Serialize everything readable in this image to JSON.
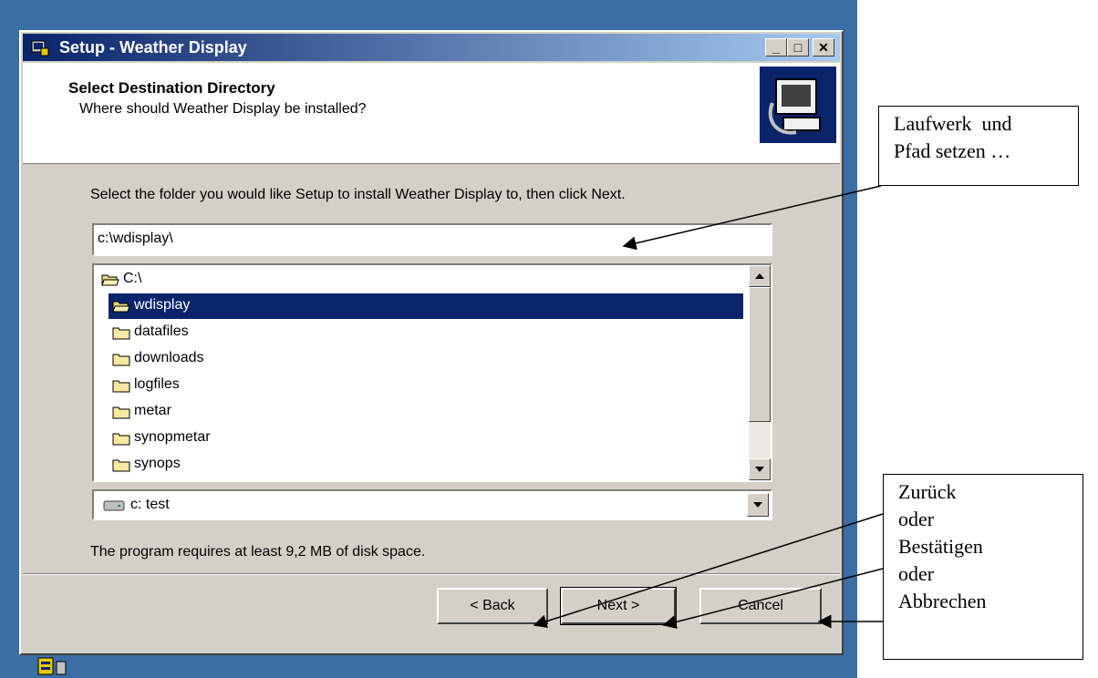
{
  "window": {
    "title": "Setup - Weather Display",
    "controls": {
      "minimize": "_",
      "maximize": "□",
      "close": "✕"
    }
  },
  "header": {
    "title": "Select Destination Directory",
    "subtitle": "Where should Weather Display be installed?",
    "image_icon": "computer-setup-icon"
  },
  "main": {
    "instruction": "Select the folder you would like Setup to install Weather Display to, then click Next.",
    "path_value": "c:\\wdisplay\\",
    "tree": [
      {
        "label": "C:\\",
        "level": 0,
        "open": true,
        "selected": false
      },
      {
        "label": "wdisplay",
        "level": 1,
        "open": true,
        "selected": true
      },
      {
        "label": "datafiles",
        "level": 1,
        "open": false,
        "selected": false
      },
      {
        "label": "downloads",
        "level": 1,
        "open": false,
        "selected": false
      },
      {
        "label": "logfiles",
        "level": 1,
        "open": false,
        "selected": false
      },
      {
        "label": "metar",
        "level": 1,
        "open": false,
        "selected": false
      },
      {
        "label": "synopmetar",
        "level": 1,
        "open": false,
        "selected": false
      },
      {
        "label": "synops",
        "level": 1,
        "open": false,
        "selected": false
      }
    ],
    "drive_selected": "c: test",
    "disk_space": "The program requires at least 9,2 MB of disk space."
  },
  "buttons": {
    "back": "< Back",
    "next": "Next >",
    "cancel": "Cancel"
  },
  "callouts": {
    "path_hint_line1": "Laufwerk  und",
    "path_hint_line2": "Pfad setzen …",
    "nav_hint_lines": [
      "Zurück",
      "oder",
      "Bestätigen",
      "oder",
      "Abbrechen"
    ]
  },
  "colors": {
    "title_active": "#0a246a",
    "face": "#d4d0c8",
    "selection": "#0a246a",
    "desktop": "#3a6ea5"
  }
}
